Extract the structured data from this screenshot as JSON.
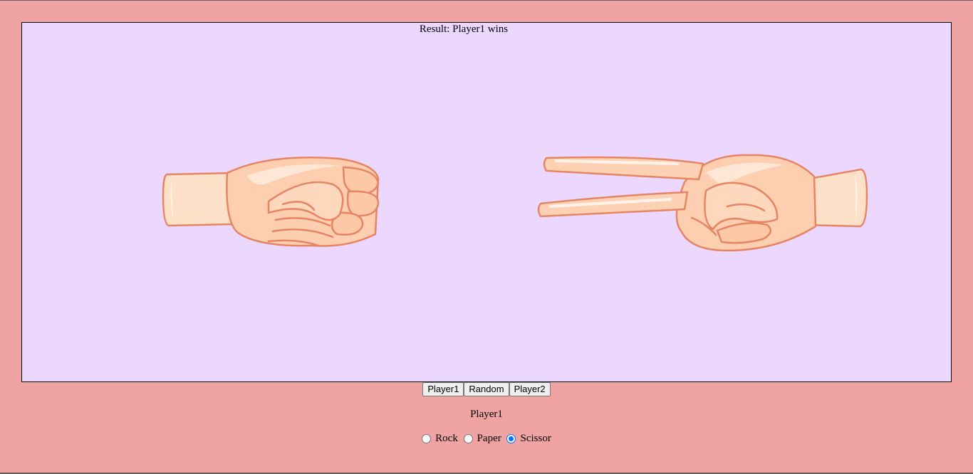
{
  "result": {
    "label": "Result:",
    "value": "Player1 wins"
  },
  "hands": {
    "left": {
      "gesture": "rock",
      "icon": "fist-icon"
    },
    "right": {
      "gesture": "scissor",
      "icon": "scissors-hand-icon"
    }
  },
  "buttons": {
    "player1": "Player1",
    "random": "Random",
    "player2": "Player2"
  },
  "current_player": "Player1",
  "choices": [
    {
      "label": "Rock",
      "checked": false
    },
    {
      "label": "Paper",
      "checked": false
    },
    {
      "label": "Scissor",
      "checked": true
    }
  ],
  "colors": {
    "page_bg": "#f0a3a3",
    "stage_bg": "#ecd7fe",
    "skin": "#fdcfb0",
    "skin_outline": "#e58563",
    "radio_accent": "#0075ff"
  }
}
